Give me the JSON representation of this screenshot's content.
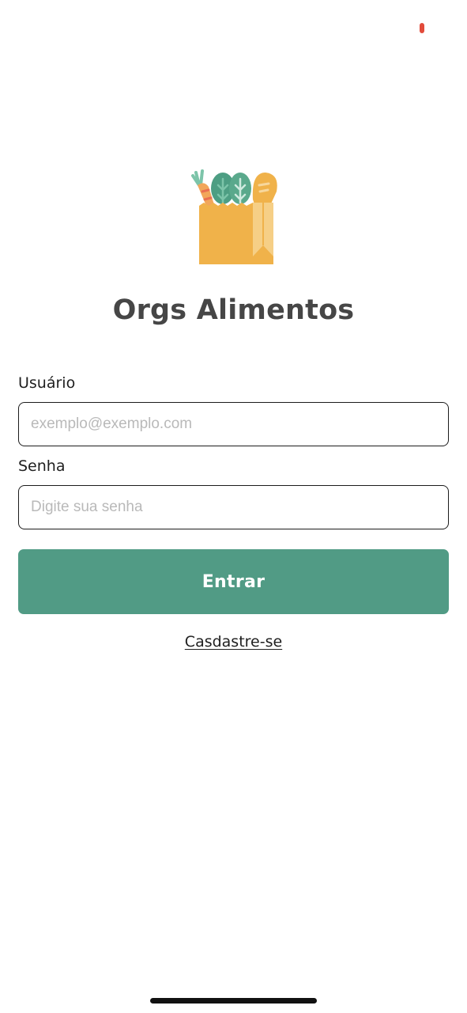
{
  "app": {
    "title": "Orgs Alimentos",
    "logo_icon": "grocery-bag-icon"
  },
  "form": {
    "user_label": "Usuário",
    "user_placeholder": "exemplo@exemplo.com",
    "user_value": "",
    "password_label": "Senha",
    "password_placeholder": "Digite sua senha",
    "password_value": "",
    "submit_label": "Entrar",
    "register_label": "Casdastre-se"
  },
  "colors": {
    "accent": "#519b85",
    "title": "#464646",
    "status_indicator": "#e24b3b",
    "bag": "#f0b24a"
  }
}
